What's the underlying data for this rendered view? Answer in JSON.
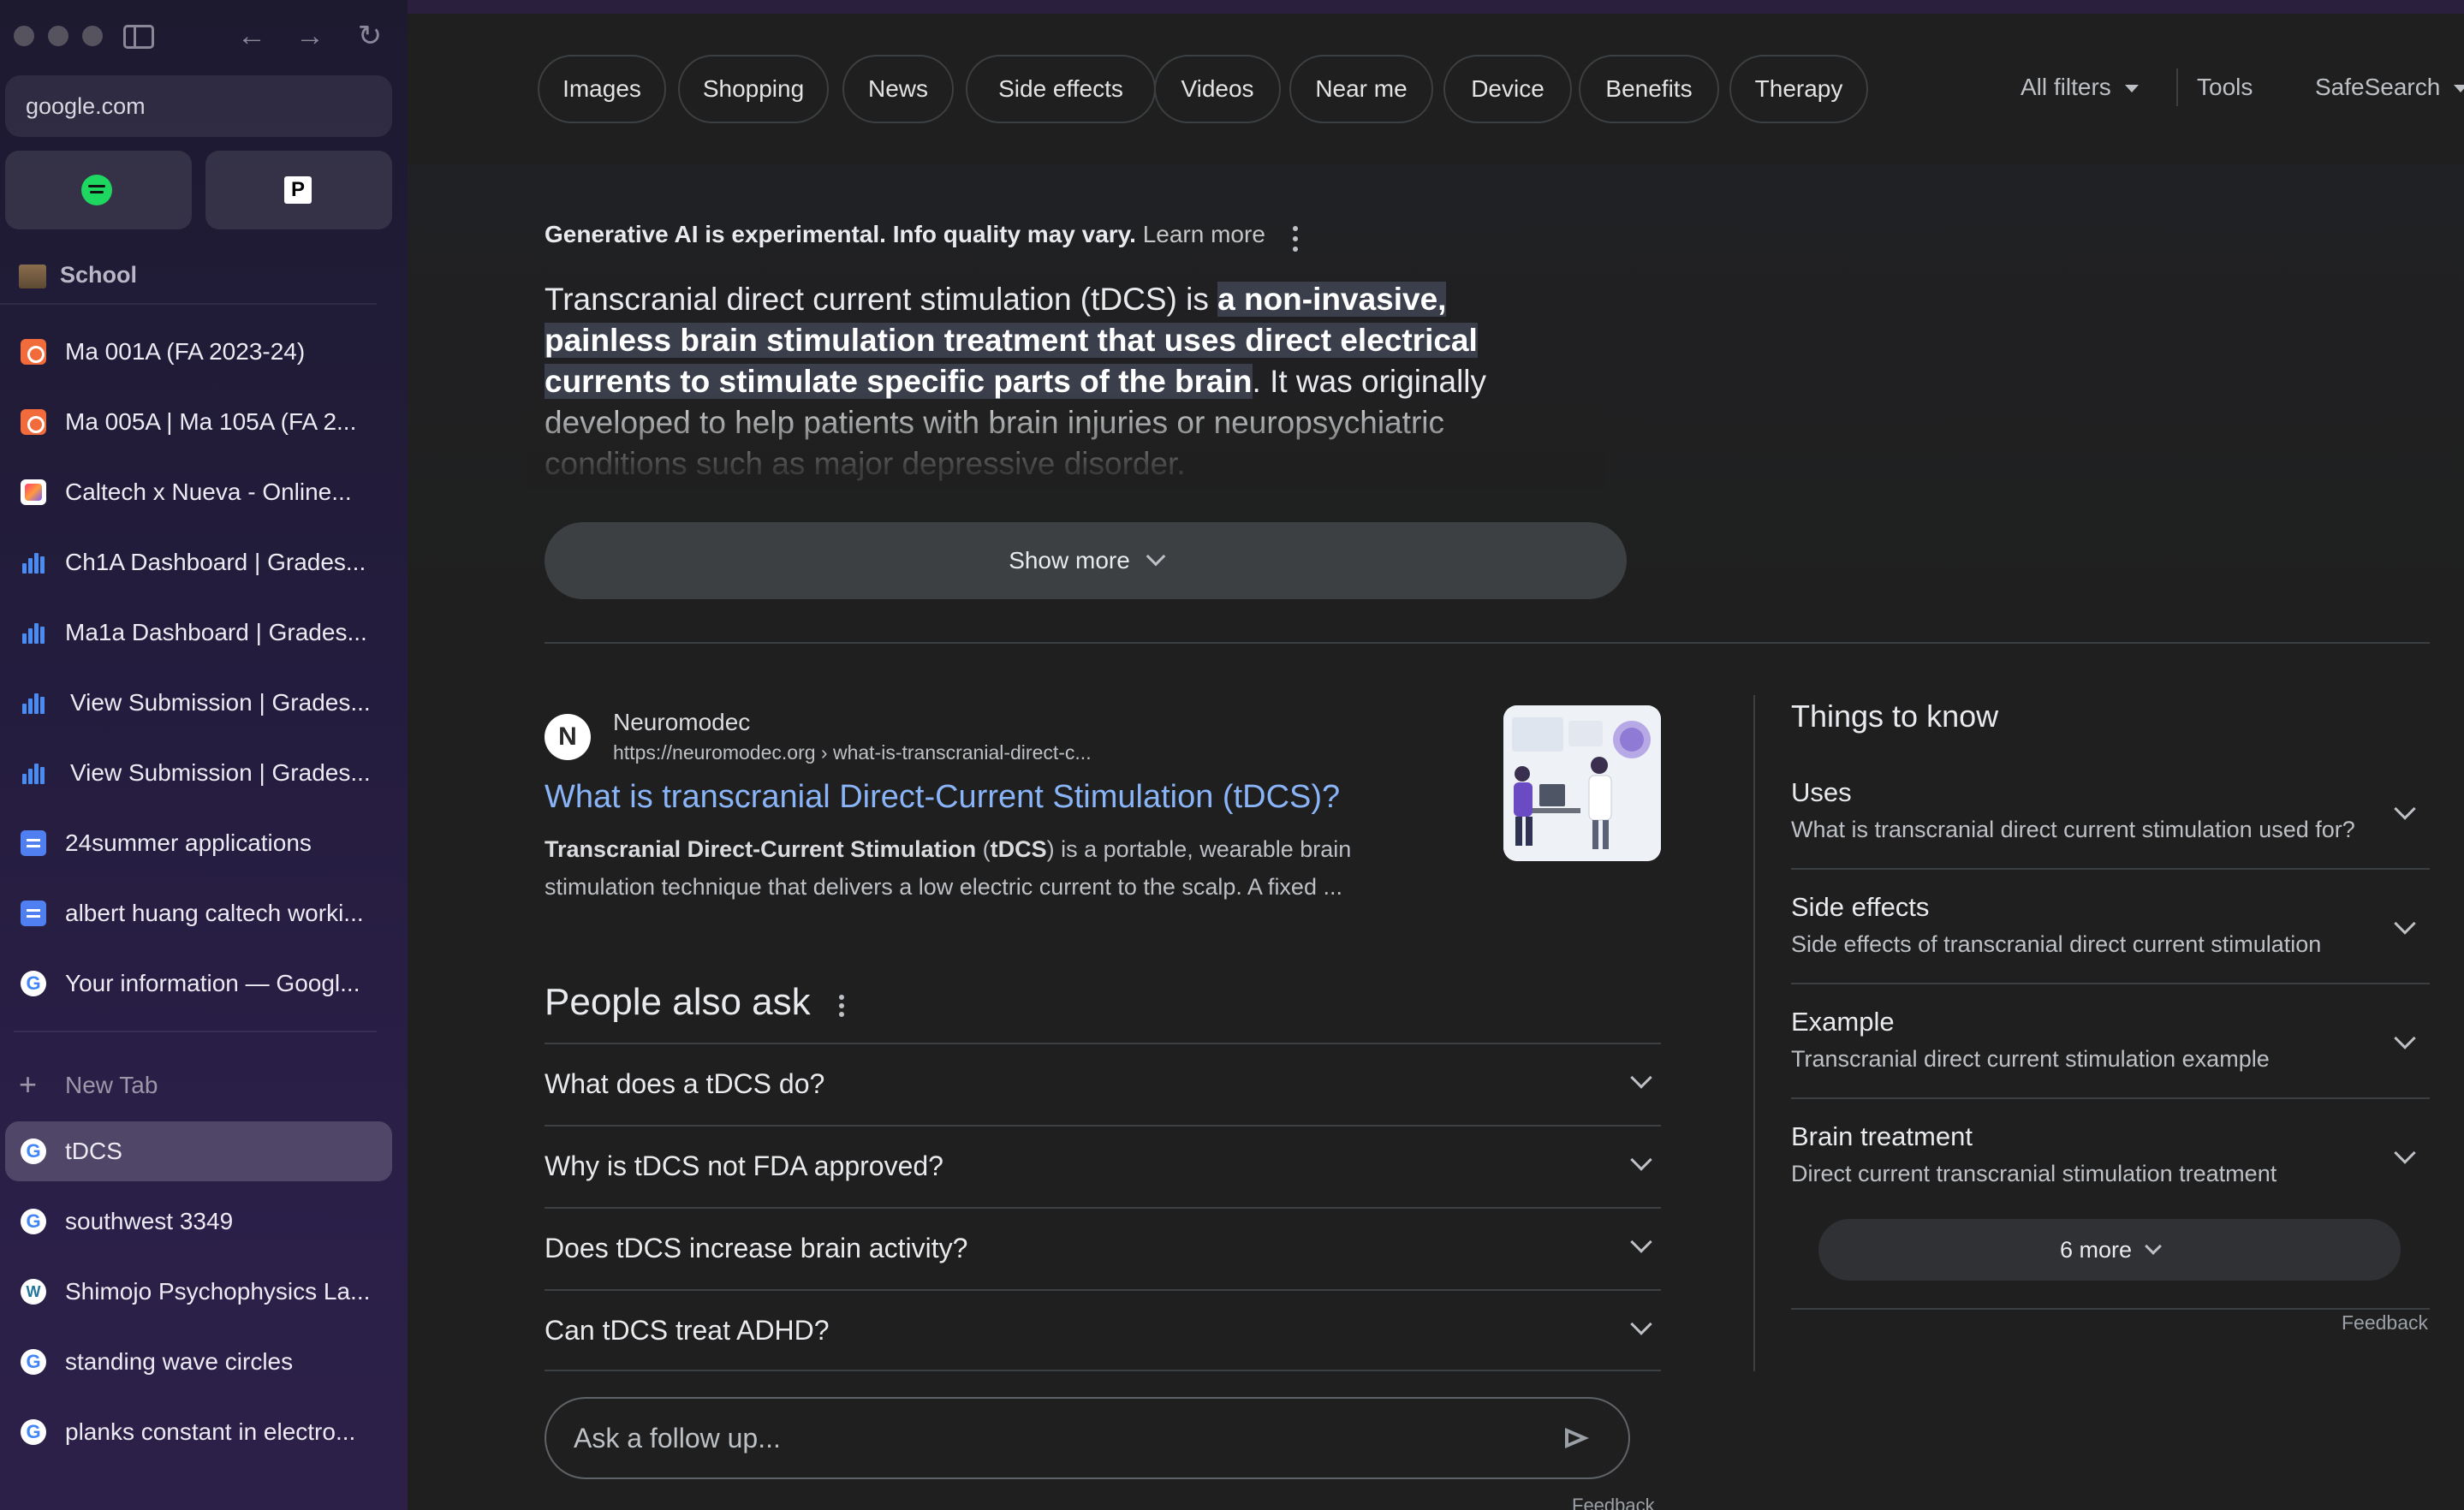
{
  "browser": {
    "url": "google.com",
    "section": "School",
    "tabs": [
      {
        "title": "Ma 001A (FA 2023-24)",
        "favicon": "canvas-icon"
      },
      {
        "title": "Ma 005A | Ma 105A (FA 2...",
        "favicon": "canvas-icon"
      },
      {
        "title": "Caltech x Nueva - Online...",
        "favicon": "app-icon"
      },
      {
        "title": "Ch1A Dashboard | Grades...",
        "favicon": "bar-chart-icon"
      },
      {
        "title": "Ma1a Dashboard | Grades...",
        "favicon": "bar-chart-icon"
      },
      {
        "title": "View Submission | Grades...",
        "favicon": "bar-chart-icon"
      },
      {
        "title": "View Submission | Grades...",
        "favicon": "bar-chart-icon"
      },
      {
        "title": "24summer applications",
        "favicon": "doc-icon"
      },
      {
        "title": "albert huang caltech worki...",
        "favicon": "doc-icon"
      },
      {
        "title": "Your information — Googl...",
        "favicon": "google-icon"
      }
    ],
    "new_tab_label": "New Tab",
    "open_tabs": [
      {
        "title": "tDCS",
        "favicon": "google-icon",
        "active": true
      },
      {
        "title": "southwest 3349",
        "favicon": "google-icon"
      },
      {
        "title": "Shimojo Psychophysics La...",
        "favicon": "wordpress-icon"
      },
      {
        "title": "standing wave circles",
        "favicon": "google-icon"
      },
      {
        "title": "planks constant in electro...",
        "favicon": "google-icon"
      }
    ]
  },
  "search": {
    "chips": [
      "Images",
      "Shopping",
      "News",
      "Side effects",
      "Videos",
      "Near me",
      "Device",
      "Benefits",
      "Therapy"
    ],
    "all_filters": "All filters",
    "tools": "Tools",
    "safesearch": "SafeSearch"
  },
  "ai_overview": {
    "notice": "Generative AI is experimental. Info quality may vary.",
    "learn_more": "Learn more",
    "text_start": "Transcranial direct current stimulation (tDCS) is ",
    "text_highlight": "a non-invasive, painless brain stimulation treatment that uses direct electrical currents to stimulate specific parts of the brain",
    "text_end": ". It was originally developed to help patients with brain injuries or neuropsychiatric conditions such as major depressive disorder.",
    "show_more": "Show more"
  },
  "result": {
    "site": "Neuromodec",
    "url": "https://neuromodec.org › what-is-transcranial-direct-c...",
    "title": "What is transcranial Direct-Current Stimulation (tDCS)?",
    "snippet_bold": "Transcranial Direct-Current Stimulation",
    "snippet_mid": " (",
    "snippet_bold2": "tDCS",
    "snippet_rest": ") is a portable, wearable brain stimulation technique that delivers a low electric current to the scalp. A fixed ..."
  },
  "people_also_ask": {
    "title": "People also ask",
    "questions": [
      "What does a tDCS do?",
      "Why is tDCS not FDA approved?",
      "Does tDCS increase brain activity?",
      "Can tDCS treat ADHD?"
    ],
    "followup_placeholder": "Ask a follow up...",
    "feedback": "Feedback"
  },
  "things_to_know": {
    "title": "Things to know",
    "items": [
      {
        "heading": "Uses",
        "sub": "What is transcranial direct current stimulation used for?"
      },
      {
        "heading": "Side effects",
        "sub": "Side effects of transcranial direct current stimulation"
      },
      {
        "heading": "Example",
        "sub": "Transcranial direct current stimulation example"
      },
      {
        "heading": "Brain treatment",
        "sub": "Direct current transcranial stimulation treatment"
      }
    ],
    "more": "6 more",
    "feedback": "Feedback"
  }
}
